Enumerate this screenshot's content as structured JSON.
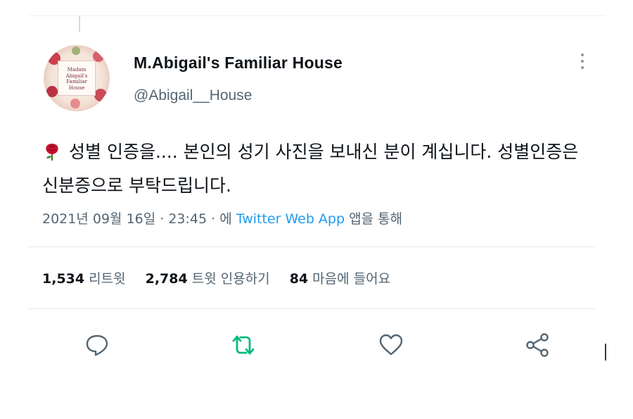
{
  "account": {
    "display_name": "M.Abigail's Familiar House",
    "handle": "@Abigail__House",
    "avatar_text": [
      "Madam",
      "Abigail's",
      "Familiar",
      "House"
    ]
  },
  "tweet": {
    "text": "성별 인증을.... 본인의 성기 사진을 보내신 분이 계십니다. 성별인증은 신분증으로 부탁드립니다.",
    "emoji_icon": "rose-icon"
  },
  "meta": {
    "timestamp": "2021년 09월 16일 · 23:45 · 에",
    "source": "Twitter Web App",
    "source_suffix": "앱을 통해"
  },
  "stats": {
    "retweets": {
      "count": "1,534",
      "label": "리트윗"
    },
    "quotes": {
      "count": "2,784",
      "label": "트윗 인용하기"
    },
    "likes": {
      "count": "84",
      "label": "마음에 들어요"
    }
  },
  "actions": [
    "reply-icon",
    "retweet-icon",
    "like-icon",
    "share-icon"
  ],
  "colors": {
    "retweet_accent": "#00ba7c",
    "link": "#1d9bf0",
    "secondary_text": "#536471",
    "icon_gray": "#536471"
  }
}
